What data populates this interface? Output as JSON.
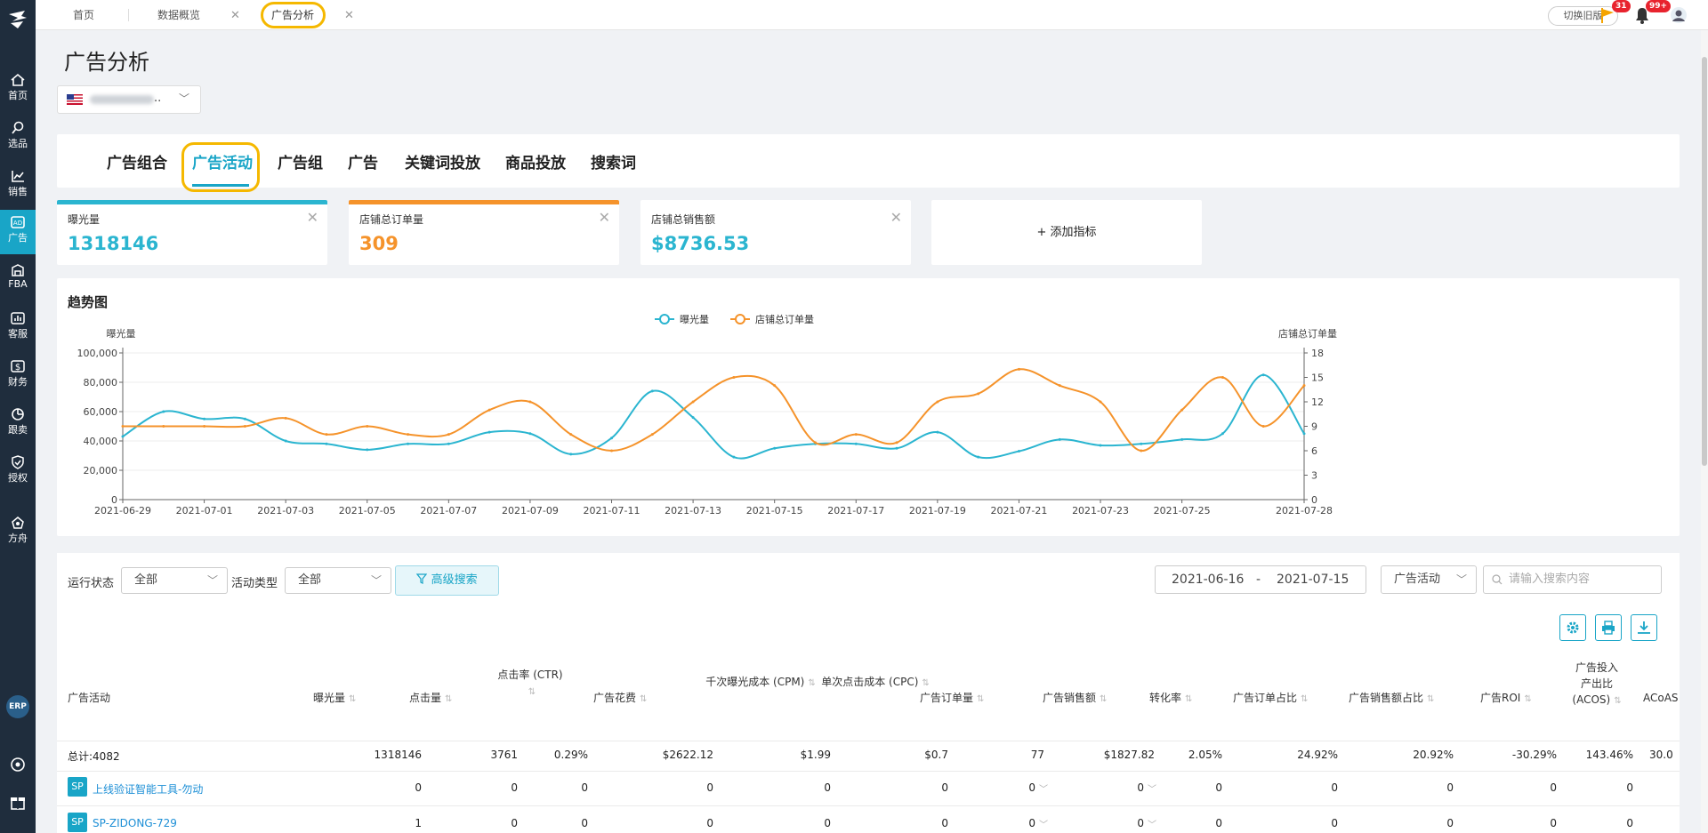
{
  "sidebar": {
    "items": [
      {
        "label": "首页",
        "icon": "home-icon"
      },
      {
        "label": "选品",
        "icon": "search-icon"
      },
      {
        "label": "销售",
        "icon": "line-chart-icon"
      },
      {
        "label": "广告",
        "icon": "ad-icon"
      },
      {
        "label": "FBA",
        "icon": "warehouse-icon"
      },
      {
        "label": "客服",
        "icon": "bar-chart-icon"
      },
      {
        "label": "财务",
        "icon": "dollar-icon"
      },
      {
        "label": "跟卖",
        "icon": "pie-chart-icon"
      },
      {
        "label": "授权",
        "icon": "shield-icon"
      },
      {
        "label": "方舟",
        "icon": "ark-icon"
      }
    ],
    "erp_label": "ERP",
    "active_color": "#19a5c7"
  },
  "tabs": [
    {
      "label": "首页"
    },
    {
      "label": "数据概览"
    },
    {
      "label": "广告分析"
    }
  ],
  "header": {
    "switch_label": "切换旧版",
    "flag_count": "31",
    "bell_count": "99+"
  },
  "page": {
    "title": "广告分析",
    "store_suffix": ".."
  },
  "type_tabs": [
    "广告组合",
    "广告活动",
    "广告组",
    "广告",
    "关键词投放",
    "商品投放",
    "搜索词"
  ],
  "metrics": [
    {
      "label": "曝光量",
      "value": "1318146",
      "color": "#2bb5d0"
    },
    {
      "label": "店铺总订单量",
      "value": "309",
      "color": "#f5932b"
    },
    {
      "label": "店铺总销售额",
      "value": "$8736.53",
      "color": "#2bb5d0"
    }
  ],
  "add_metric_label": "+ 添加指标",
  "chart_data": {
    "type": "line",
    "title": "趋势图",
    "ylabel_left": "曝光量",
    "ylabel_right": "店铺总订单量",
    "x": [
      "2021-06-29",
      "2021-06-30",
      "2021-07-01",
      "2021-07-02",
      "2021-07-03",
      "2021-07-04",
      "2021-07-05",
      "2021-07-06",
      "2021-07-07",
      "2021-07-08",
      "2021-07-09",
      "2021-07-10",
      "2021-07-11",
      "2021-07-12",
      "2021-07-13",
      "2021-07-14",
      "2021-07-15",
      "2021-07-16",
      "2021-07-17",
      "2021-07-18",
      "2021-07-19",
      "2021-07-20",
      "2021-07-21",
      "2021-07-22",
      "2021-07-23",
      "2021-07-24",
      "2021-07-25",
      "2021-07-26",
      "2021-07-27",
      "2021-07-28"
    ],
    "x_tick_labels": [
      "2021-06-29",
      "2021-07-01",
      "2021-07-03",
      "2021-07-05",
      "2021-07-07",
      "2021-07-09",
      "2021-07-11",
      "2021-07-13",
      "2021-07-15",
      "2021-07-17",
      "2021-07-19",
      "2021-07-21",
      "2021-07-23",
      "2021-07-25",
      "2021-07-28"
    ],
    "left_axis": {
      "min": 0,
      "max": 100000,
      "ticks": [
        "0",
        "20,000",
        "40,000",
        "60,000",
        "80,000",
        "100,000"
      ]
    },
    "right_axis": {
      "min": 0,
      "max": 18,
      "ticks": [
        "0",
        "3",
        "6",
        "9",
        "12",
        "15",
        "18"
      ]
    },
    "series": [
      {
        "name": "曝光量",
        "axis": "left",
        "color": "#2bb5d0",
        "values": [
          43000,
          60000,
          55000,
          55000,
          40000,
          38000,
          34000,
          38000,
          38000,
          46000,
          45000,
          31000,
          42000,
          74000,
          56000,
          29000,
          35000,
          38000,
          38000,
          35000,
          46000,
          29000,
          33000,
          41000,
          37000,
          38000,
          41000,
          45000,
          85000,
          45000
        ]
      },
      {
        "name": "店铺总订单量",
        "axis": "right",
        "color": "#f5932b",
        "values": [
          9,
          9,
          9,
          9,
          10,
          8,
          9,
          8,
          8,
          11,
          12,
          8,
          6,
          8,
          12,
          15,
          14,
          7,
          8,
          7,
          12,
          13,
          16,
          14,
          12,
          6,
          11,
          15,
          9,
          14
        ]
      }
    ]
  },
  "filters": {
    "status_label": "运行状态",
    "status_value": "全部",
    "type_label": "活动类型",
    "type_value": "全部",
    "advanced_label": "高级搜索",
    "date_start": "2021-06-16",
    "date_sep": "-",
    "date_end": "2021-07-15",
    "scope_value": "广告活动",
    "search_placeholder": "请输入搜索内容"
  },
  "table": {
    "columns": [
      {
        "label": "广告活动"
      },
      {
        "label": "曝光量"
      },
      {
        "label": "点击量"
      },
      {
        "label": "点击率 (CTR)"
      },
      {
        "label": "广告花费"
      },
      {
        "label": "千次曝光成本 (CPM)"
      },
      {
        "label": "单次点击成本 (CPC)"
      },
      {
        "label": "广告订单量"
      },
      {
        "label": "广告销售额"
      },
      {
        "label": "转化率"
      },
      {
        "label": "广告订单占比"
      },
      {
        "label": "广告销售额占比"
      },
      {
        "label": "广告ROI"
      },
      {
        "label": "广告投入产出比 (ACOS)"
      },
      {
        "label": "ACoAS"
      }
    ],
    "summary": [
      "总计:4082",
      "1318146",
      "3761",
      "0.29%",
      "$2622.12",
      "$1.99",
      "$0.7",
      "77",
      "$1827.82",
      "2.05%",
      "24.92%",
      "20.92%",
      "-30.29%",
      "143.46%",
      "30.0"
    ],
    "rows": [
      {
        "tag": "SP",
        "name": "上线验证智能工具-勿动",
        "values": [
          "0",
          "0",
          "0",
          "0",
          "0",
          "0",
          "0",
          "0",
          "0",
          "0",
          "0",
          "0",
          "0"
        ]
      },
      {
        "tag": "SP",
        "name": "SP-ZIDONG-729",
        "values": [
          "1",
          "0",
          "0",
          "0",
          "0",
          "0",
          "0",
          "0",
          "0",
          "0",
          "0",
          "0",
          "0"
        ]
      }
    ]
  }
}
